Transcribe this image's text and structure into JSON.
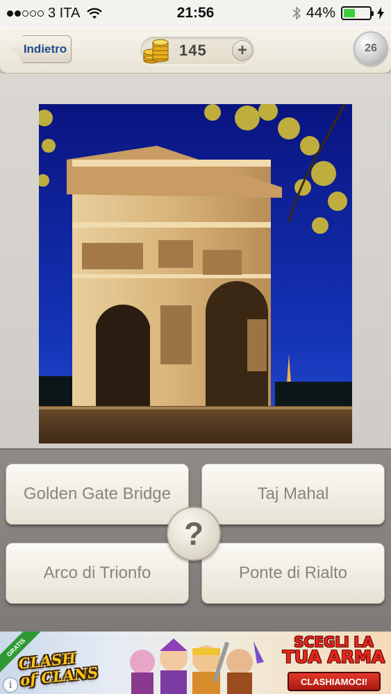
{
  "status_bar": {
    "signal_dots": [
      true,
      true,
      false,
      false,
      false
    ],
    "carrier": "3 ITA",
    "time": "21:56",
    "battery_percent": "44%",
    "battery_level": 0.44,
    "battery_color": "#3bd03b"
  },
  "top_bar": {
    "back_label": "Indietro",
    "coins": "145",
    "add_label": "+",
    "level": "26"
  },
  "quiz": {
    "photo_icon": "arc-de-triomphe-photo",
    "answers": [
      "Golden Gate Bridge",
      "Taj Mahal",
      "Arco di Trionfo",
      "Ponte di Rialto"
    ],
    "hint_label": "?"
  },
  "ad": {
    "ribbon": "GRATIS",
    "logo_line1": "CLASH",
    "logo_line2": "of CLANS",
    "headline_line1": "SCEGLI LA",
    "headline_line2": "TUA ARMA",
    "cta": "CLASHIAMOCI!",
    "info": "i"
  },
  "colors": {
    "back_text": "#204a92",
    "answer_text": "#8a8578",
    "sky": "#0b1a8c",
    "ad_headline": "#e8261b"
  }
}
